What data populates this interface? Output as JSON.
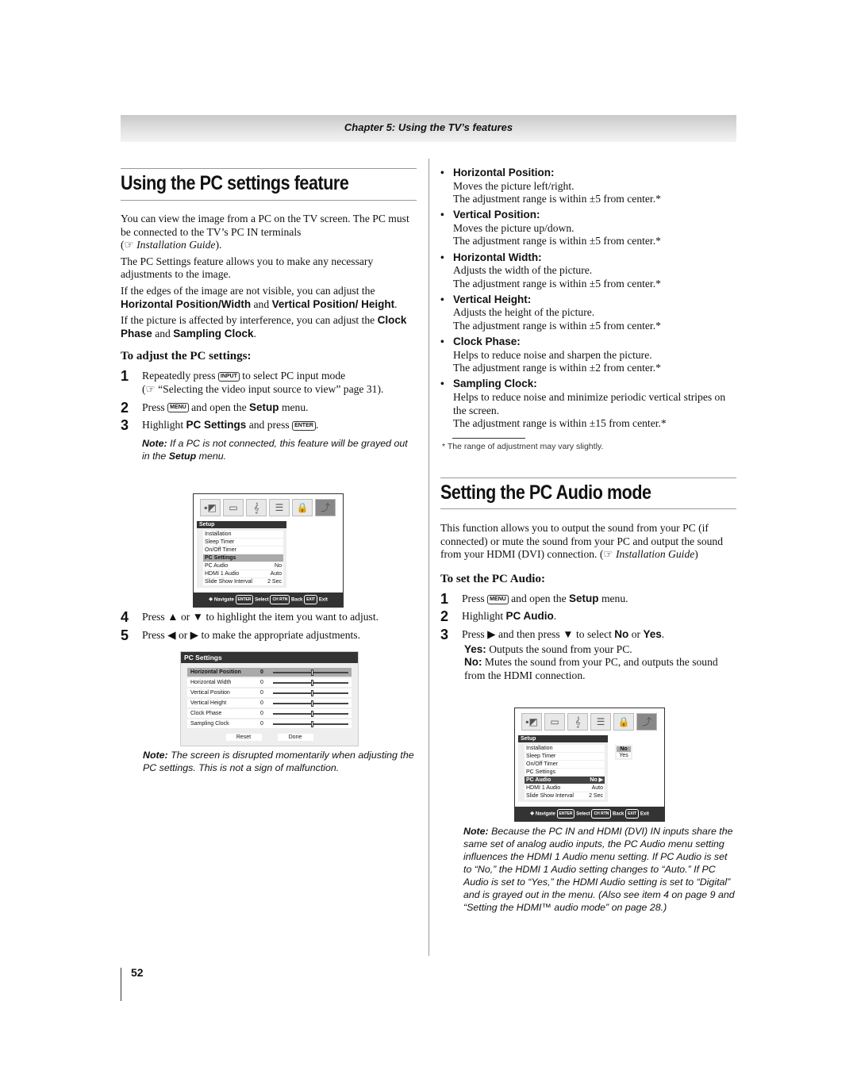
{
  "header": {
    "chapter": "Chapter 5: Using the TV’s features"
  },
  "left": {
    "title": "Using the PC settings feature",
    "p1": "You can view the image from a PC on the TV screen. The PC must be connected to the TV’s PC IN terminals",
    "p1_ref": "Installation Guide",
    "p2": "The PC Settings feature allows you to make any necessary adjustments to the image.",
    "p3_a": "If the edges of the image are not visible, you can adjust the",
    "p3_b": "Horizontal Position/Width",
    "p3_and": "and",
    "p3_c": "Vertical Position/ Height",
    "p4_a": "If the picture is affected by interference, you can adjust the",
    "p4_b": "Clock Phase",
    "p4_and": "and",
    "p4_c": "Sampling Clock",
    "subhead": "To adjust the PC settings:",
    "steps": [
      {
        "n": "1",
        "a": "Repeatedly press",
        "btn": "INPUT",
        "b": "to select PC input mode",
        "ref": "“Selecting the video input source to view” page 31)."
      },
      {
        "n": "2",
        "a": "Press",
        "btn": "MENU",
        "b": "and open the",
        "c": "Setup",
        "d": "menu."
      },
      {
        "n": "3",
        "a": "Highlight",
        "c": "PC Settings",
        "b": "and press",
        "btn": "ENTER"
      },
      {
        "n": "4",
        "a": "Press ▲ or ▼ to highlight the item you want to adjust."
      },
      {
        "n": "5",
        "a": "Press ◀ or ▶ to make the appropriate adjustments."
      }
    ],
    "note1_label": "Note:",
    "note1": "If a PC is not connected, this feature will be grayed out in the",
    "note1_b": "Setup",
    "note1_c": "menu.",
    "note2_label": "Note:",
    "note2": "The screen is disrupted momentarily when adjusting the PC settings. This is not a sign of malfunction."
  },
  "menu1": {
    "title": "Setup",
    "rows": [
      [
        "Installation",
        ""
      ],
      [
        "Sleep Timer",
        ""
      ],
      [
        "On/Off Timer",
        ""
      ],
      [
        "PC Settings",
        ""
      ],
      [
        "PC Audio",
        "No"
      ],
      [
        "HDMI 1 Audio",
        "Auto"
      ],
      [
        "Slide Show Interval",
        "2 Sec"
      ]
    ],
    "footer": [
      "Navigate",
      "ENTER",
      "Select",
      "CH RTN",
      "Back",
      "EXIT",
      "Exit"
    ]
  },
  "pc_settings": {
    "title": "PC Settings",
    "rows": [
      [
        "Horizontal Position",
        "0"
      ],
      [
        "Horizontal Width",
        "0"
      ],
      [
        "Vertical Position",
        "0"
      ],
      [
        "Vertical Height",
        "0"
      ],
      [
        "Clock Phase",
        "0"
      ],
      [
        "Sampling Clock",
        "0"
      ]
    ],
    "slider_value": 0,
    "slider_range": [
      -5,
      5
    ],
    "buttons": [
      "Reset",
      "Done"
    ]
  },
  "right": {
    "items": [
      {
        "h": "Horizontal Position:",
        "l1": "Moves the picture left/right.",
        "l2": "The adjustment range is within ±5 from center.*"
      },
      {
        "h": "Vertical Position:",
        "l1": "Moves the picture up/down.",
        "l2": "The adjustment range is within ±5 from center.*"
      },
      {
        "h": "Horizontal Width:",
        "l1": "Adjusts the width of the picture.",
        "l2": "The adjustment range is within ±5 from center.*"
      },
      {
        "h": "Vertical Height:",
        "l1": "Adjusts the height of the picture.",
        "l2": "The adjustment range is within ±5 from center.*"
      },
      {
        "h": "Clock Phase:",
        "l1": "Helps to reduce noise and sharpen the picture.",
        "l2": "The adjustment range is within ±2 from center.*"
      },
      {
        "h": "Sampling Clock:",
        "l1": "Helps to reduce noise and minimize periodic vertical stripes on the screen.",
        "l2": "The adjustment range is within ±15 from center.*"
      }
    ],
    "footnote": "*  The range of adjustment may vary slightly.",
    "title": "Setting the PC Audio mode",
    "p1": "This function allows you to output the sound from your PC (if connected) or mute the sound from your PC and output the sound from your HDMI (DVI) connection. (",
    "p1_ref": "Installation Guide",
    "subhead": "To set the PC Audio:",
    "s1a": "Press",
    "s1btn": "MENU",
    "s1b": "and open the",
    "s1c": "Setup",
    "s1d": "menu.",
    "s2a": "Highlight",
    "s2b": "PC Audio",
    "s3a": "Press ▶ and then press ▼ to select",
    "s3b": "No",
    "s3or": "or",
    "s3c": "Yes",
    "yes_label": "Yes:",
    "yes_text": "Outputs the sound from your PC.",
    "no_label": "No:",
    "no_text": "Mutes the sound from your PC, and outputs the sound from the HDMI connection.",
    "note_label": "Note:",
    "note": "Because the PC IN and HDMI (DVI) IN inputs share the same set of analog audio inputs, the PC Audio menu setting influences the HDMI 1 Audio menu setting. If PC Audio is set to “No,” the HDMI 1 Audio setting changes to “Auto.” If PC Audio is set to “Yes,” the HDMI Audio setting is set to “Digital” and is grayed out in the menu. (Also see item 4 on page 9 and “Setting the HDMI™ audio mode” on page 28.)"
  },
  "menu2": {
    "title": "Setup",
    "rows": [
      [
        "Installation",
        ""
      ],
      [
        "Sleep Timer",
        ""
      ],
      [
        "On/Off Timer",
        ""
      ],
      [
        "PC Settings",
        ""
      ],
      [
        "PC Audio",
        "No ▶"
      ],
      [
        "HDMI 1 Audio",
        "Auto"
      ],
      [
        "Slide Show Interval",
        "2 Sec"
      ]
    ],
    "options": [
      "No",
      "Yes"
    ]
  },
  "page_number": "52"
}
